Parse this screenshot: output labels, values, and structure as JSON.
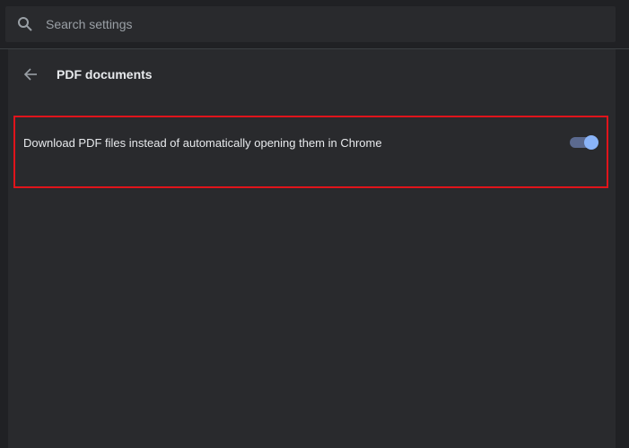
{
  "search": {
    "placeholder": "Search settings"
  },
  "header": {
    "title": "PDF documents",
    "back_icon": "arrow-back-icon"
  },
  "setting": {
    "label": "Download PDF files instead of automatically opening them in Chrome",
    "toggle_state": "on"
  },
  "colors": {
    "background": "#202124",
    "card": "#292a2d",
    "toggle_accent": "#8ab4f8",
    "highlight": "#e0141b"
  }
}
